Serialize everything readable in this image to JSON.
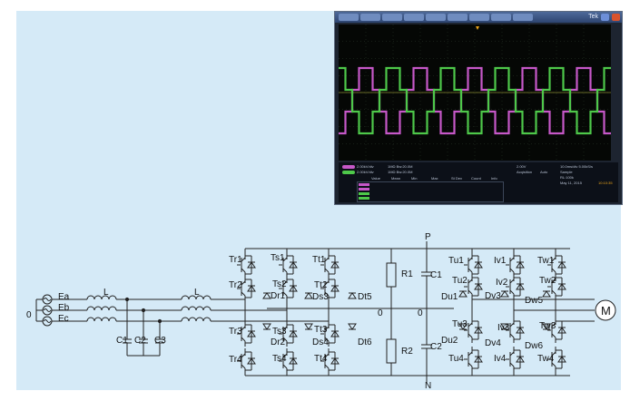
{
  "scope": {
    "title": "Tek",
    "ch1_scale": "2.00kV/div",
    "ch2_scale": "2.00kV/div",
    "bw1": "1MΩ Bw:20.0M",
    "bw2": "1MΩ Bw:20.0M",
    "trigger_ch": "2.00V",
    "acquisition": "Acqisition",
    "acq_mode": "Auto",
    "timebase": "10.0ms/div 5.00kS/s",
    "record": "Sample",
    "rl": "RL:100k",
    "date": "May 11, 2015",
    "time": "10:10:35",
    "meas_headers": [
      "Value",
      "Mean",
      "Min",
      "Max",
      "St Dev",
      "Count",
      "Info"
    ]
  },
  "labels": {
    "ea": "Ea",
    "eb": "Eb",
    "ec": "Ec",
    "zero_left": "0",
    "l1": "L",
    "l2": "L",
    "c1": "C1",
    "c2": "C2",
    "c3": "C3",
    "tr1": "Tr1",
    "tr2": "Tr2",
    "tr3": "Tr3",
    "tr4": "Tr4",
    "ts1": "Ts1",
    "ts2": "Ts2",
    "ts3": "Ts3",
    "ts4": "Ts4",
    "tt1": "Tt1",
    "tt2": "Tt2",
    "tt3": "Tt3",
    "tt4": "Tt4",
    "dr1": "Dr1",
    "dr2": "Dr2",
    "ds3": "Ds3",
    "ds4": "Ds4",
    "dt5": "Dt5",
    "dt6": "Dt6",
    "r1": "R1",
    "r2": "R2",
    "c1b": "C1",
    "c2b": "C2",
    "p": "P",
    "n": "N",
    "zero_mid1": "0",
    "zero_mid2": "0",
    "tu1": "Tu1",
    "tu2": "Tu2",
    "tu3": "Tu3",
    "tu4": "Tu4",
    "iv1": "Iv1",
    "iv2": "Iv2",
    "iv3": "Iv3",
    "iv4": "Iv4",
    "tw1": "Tw1",
    "tw2": "Tw2",
    "tw3": "Tw3",
    "tw4": "Tw4",
    "du1": "Du1",
    "du2": "Du2",
    "dv3": "Dv3",
    "dv4": "Dv4",
    "dw5": "Dw5",
    "dw6": "Dw6",
    "motor": "M"
  },
  "colors": {
    "background": "#d5eaf7",
    "ch1": "#c658c8",
    "ch2": "#4ec84a"
  }
}
